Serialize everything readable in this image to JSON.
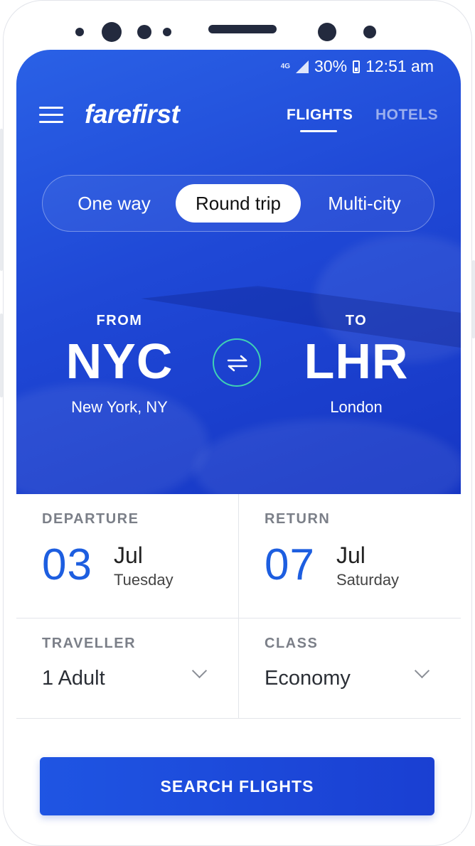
{
  "status_bar": {
    "network": "4G",
    "battery": "30%",
    "time": "12:51 am"
  },
  "header": {
    "logo": "farefirst",
    "tabs": [
      {
        "label": "FLIGHTS",
        "active": true
      },
      {
        "label": "HOTELS",
        "active": false
      }
    ]
  },
  "trip_types": [
    "One way",
    "Round trip",
    "Multi-city"
  ],
  "selected_trip_type": "Round trip",
  "route": {
    "from": {
      "label": "FROM",
      "code": "NYC",
      "city": "New York, NY"
    },
    "to": {
      "label": "TO",
      "code": "LHR",
      "city": "London"
    }
  },
  "departure": {
    "label": "DEPARTURE",
    "day": "03",
    "month": "Jul",
    "weekday": "Tuesday"
  },
  "return": {
    "label": "RETURN",
    "day": "07",
    "month": "Jul",
    "weekday": "Saturday"
  },
  "traveller": {
    "label": "TRAVELLER",
    "value": "1 Adult"
  },
  "cabin_class": {
    "label": "CLASS",
    "value": "Economy"
  },
  "search_button": "SEARCH FLIGHTS",
  "colors": {
    "brand_blue": "#1f48d6",
    "accent_blue": "#1d5ee0",
    "swap_ring": "#3fd1b4"
  },
  "icons": {
    "menu": "hamburger-icon",
    "swap": "swap-arrows-icon",
    "dropdown": "chevron-down-icon",
    "battery": "battery-icon",
    "signal": "signal-icon"
  }
}
